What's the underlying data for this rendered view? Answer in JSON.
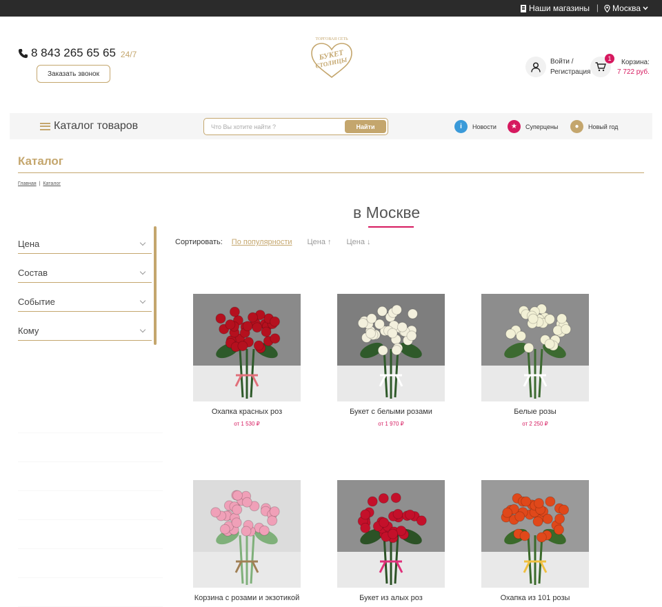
{
  "topbar": {
    "stores_label": "Наши магазины",
    "separator": "|",
    "city_label": "Москва"
  },
  "header": {
    "phone": "8 843 265 65 65",
    "phone_hours": "24/7",
    "callback_label": "Заказать звонок",
    "logo_top": "ТОРГОВАЯ СЕТЬ",
    "logo_line1": "БУКЕТ",
    "logo_line2": "СТОЛИЦЫ",
    "login_line1": "Войти /",
    "login_line2": "Регистрация",
    "cart_count": "1",
    "cart_label": "Корзина:",
    "cart_total": "7 722 руб."
  },
  "nav": {
    "catalog_label": "Каталог товаров",
    "search_placeholder": "Что Вы хотите найти ?",
    "search_button": "Найти",
    "links": [
      {
        "label": "Новости",
        "color": "#3a9ad9",
        "icon": "i"
      },
      {
        "label": "Суперцены",
        "color": "#d6195f",
        "icon": "★"
      },
      {
        "label": "Новый год",
        "color": "#c4a66d",
        "icon": "●"
      }
    ]
  },
  "page": {
    "title": "Каталог",
    "breadcrumb": [
      "Главная",
      "|",
      "Каталог"
    ],
    "city_title": "в Москве"
  },
  "filters": [
    "Цена",
    "Состав",
    "Событие",
    "Кому"
  ],
  "sort": {
    "label": "Сортировать:",
    "active": "По популярности",
    "options": [
      "Цена ↑",
      "Цена ↓"
    ]
  },
  "products": [
    {
      "name": "Охапка красных роз",
      "price": "от 1 530 ₽",
      "bg": "#8a8a8a",
      "flower": "#b5101e",
      "leaf": "#2e5a2a",
      "ribbon": "#e0707a"
    },
    {
      "name": "Букет с белыми розами",
      "price": "от 1 970 ₽",
      "bg": "#7e7e7e",
      "flower": "#f3f0dd",
      "leaf": "#2f5a2a",
      "ribbon": "#ffffff"
    },
    {
      "name": "Белые розы",
      "price": "от 2 250 ₽",
      "bg": "#8d8d8d",
      "flower": "#f2f0d5",
      "leaf": "#3c6a30",
      "ribbon": "#ffffff"
    },
    {
      "name": "Корзина с розами и экзотикой",
      "price": "",
      "bg": "#dcdcdc",
      "flower": "#f0a0b8",
      "leaf": "#7fb07a",
      "ribbon": "#a08055"
    },
    {
      "name": "Букет из алых роз",
      "price": "",
      "bg": "#8f8f8f",
      "flower": "#c4102a",
      "leaf": "#2c5226",
      "ribbon": "#e0307a"
    },
    {
      "name": "Охапка из 101 розы",
      "price": "",
      "bg": "#9a9a9a",
      "flower": "#e0481a",
      "leaf": "#3a6a2a",
      "ribbon": "#f0c040"
    }
  ]
}
